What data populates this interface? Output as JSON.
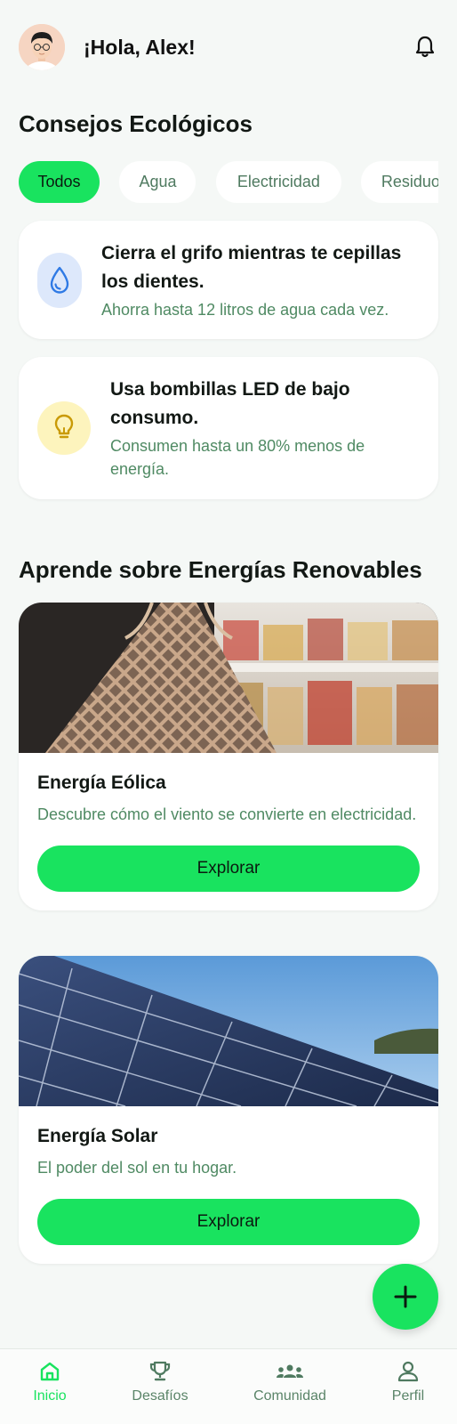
{
  "header": {
    "greeting": "¡Hola, Alex!"
  },
  "tips_section": {
    "title": "Consejos Ecológicos",
    "chips": [
      "Todos",
      "Agua",
      "Electricidad",
      "Residuos"
    ],
    "active_chip": "Todos",
    "tips": [
      {
        "icon": "water-drop-icon",
        "title": "Cierra el grifo mientras te cepillas los dientes.",
        "subtitle": "Ahorra hasta 12 litros de agua cada vez."
      },
      {
        "icon": "lightbulb-icon",
        "title": "Usa bombillas LED de bajo consumo.",
        "subtitle": "Consumen hasta un 80% menos de energía."
      }
    ]
  },
  "learn_section": {
    "title": "Aprende sobre Energías Renovables",
    "cards": [
      {
        "title": "Energía Eólica",
        "description": "Descubre cómo el viento se convierte en electricidad.",
        "button": "Explorar"
      },
      {
        "title": "Energía Solar",
        "description": "El poder del sol en tu hogar.",
        "button": "Explorar"
      }
    ]
  },
  "bottom_nav": {
    "items": [
      "Inicio",
      "Desafíos",
      "Comunidad",
      "Perfil"
    ],
    "active": "Inicio"
  },
  "colors": {
    "accent": "#19e35f",
    "secondary_text": "#4f8a63",
    "background": "#f5f8f6"
  }
}
